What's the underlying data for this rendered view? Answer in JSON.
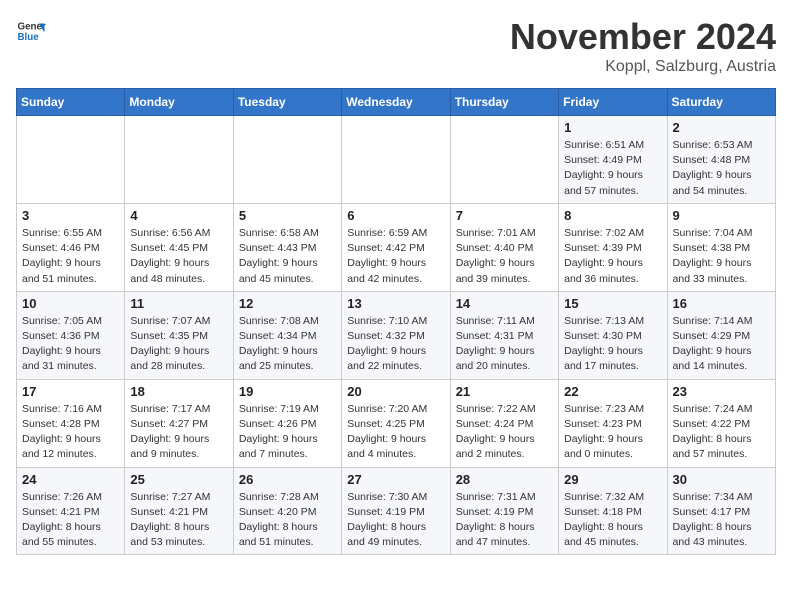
{
  "header": {
    "logo_line1": "General",
    "logo_line2": "Blue",
    "month": "November 2024",
    "location": "Koppl, Salzburg, Austria"
  },
  "weekdays": [
    "Sunday",
    "Monday",
    "Tuesday",
    "Wednesday",
    "Thursday",
    "Friday",
    "Saturday"
  ],
  "weeks": [
    [
      {
        "day": "",
        "info": ""
      },
      {
        "day": "",
        "info": ""
      },
      {
        "day": "",
        "info": ""
      },
      {
        "day": "",
        "info": ""
      },
      {
        "day": "",
        "info": ""
      },
      {
        "day": "1",
        "info": "Sunrise: 6:51 AM\nSunset: 4:49 PM\nDaylight: 9 hours and 57 minutes."
      },
      {
        "day": "2",
        "info": "Sunrise: 6:53 AM\nSunset: 4:48 PM\nDaylight: 9 hours and 54 minutes."
      }
    ],
    [
      {
        "day": "3",
        "info": "Sunrise: 6:55 AM\nSunset: 4:46 PM\nDaylight: 9 hours and 51 minutes."
      },
      {
        "day": "4",
        "info": "Sunrise: 6:56 AM\nSunset: 4:45 PM\nDaylight: 9 hours and 48 minutes."
      },
      {
        "day": "5",
        "info": "Sunrise: 6:58 AM\nSunset: 4:43 PM\nDaylight: 9 hours and 45 minutes."
      },
      {
        "day": "6",
        "info": "Sunrise: 6:59 AM\nSunset: 4:42 PM\nDaylight: 9 hours and 42 minutes."
      },
      {
        "day": "7",
        "info": "Sunrise: 7:01 AM\nSunset: 4:40 PM\nDaylight: 9 hours and 39 minutes."
      },
      {
        "day": "8",
        "info": "Sunrise: 7:02 AM\nSunset: 4:39 PM\nDaylight: 9 hours and 36 minutes."
      },
      {
        "day": "9",
        "info": "Sunrise: 7:04 AM\nSunset: 4:38 PM\nDaylight: 9 hours and 33 minutes."
      }
    ],
    [
      {
        "day": "10",
        "info": "Sunrise: 7:05 AM\nSunset: 4:36 PM\nDaylight: 9 hours and 31 minutes."
      },
      {
        "day": "11",
        "info": "Sunrise: 7:07 AM\nSunset: 4:35 PM\nDaylight: 9 hours and 28 minutes."
      },
      {
        "day": "12",
        "info": "Sunrise: 7:08 AM\nSunset: 4:34 PM\nDaylight: 9 hours and 25 minutes."
      },
      {
        "day": "13",
        "info": "Sunrise: 7:10 AM\nSunset: 4:32 PM\nDaylight: 9 hours and 22 minutes."
      },
      {
        "day": "14",
        "info": "Sunrise: 7:11 AM\nSunset: 4:31 PM\nDaylight: 9 hours and 20 minutes."
      },
      {
        "day": "15",
        "info": "Sunrise: 7:13 AM\nSunset: 4:30 PM\nDaylight: 9 hours and 17 minutes."
      },
      {
        "day": "16",
        "info": "Sunrise: 7:14 AM\nSunset: 4:29 PM\nDaylight: 9 hours and 14 minutes."
      }
    ],
    [
      {
        "day": "17",
        "info": "Sunrise: 7:16 AM\nSunset: 4:28 PM\nDaylight: 9 hours and 12 minutes."
      },
      {
        "day": "18",
        "info": "Sunrise: 7:17 AM\nSunset: 4:27 PM\nDaylight: 9 hours and 9 minutes."
      },
      {
        "day": "19",
        "info": "Sunrise: 7:19 AM\nSunset: 4:26 PM\nDaylight: 9 hours and 7 minutes."
      },
      {
        "day": "20",
        "info": "Sunrise: 7:20 AM\nSunset: 4:25 PM\nDaylight: 9 hours and 4 minutes."
      },
      {
        "day": "21",
        "info": "Sunrise: 7:22 AM\nSunset: 4:24 PM\nDaylight: 9 hours and 2 minutes."
      },
      {
        "day": "22",
        "info": "Sunrise: 7:23 AM\nSunset: 4:23 PM\nDaylight: 9 hours and 0 minutes."
      },
      {
        "day": "23",
        "info": "Sunrise: 7:24 AM\nSunset: 4:22 PM\nDaylight: 8 hours and 57 minutes."
      }
    ],
    [
      {
        "day": "24",
        "info": "Sunrise: 7:26 AM\nSunset: 4:21 PM\nDaylight: 8 hours and 55 minutes."
      },
      {
        "day": "25",
        "info": "Sunrise: 7:27 AM\nSunset: 4:21 PM\nDaylight: 8 hours and 53 minutes."
      },
      {
        "day": "26",
        "info": "Sunrise: 7:28 AM\nSunset: 4:20 PM\nDaylight: 8 hours and 51 minutes."
      },
      {
        "day": "27",
        "info": "Sunrise: 7:30 AM\nSunset: 4:19 PM\nDaylight: 8 hours and 49 minutes."
      },
      {
        "day": "28",
        "info": "Sunrise: 7:31 AM\nSunset: 4:19 PM\nDaylight: 8 hours and 47 minutes."
      },
      {
        "day": "29",
        "info": "Sunrise: 7:32 AM\nSunset: 4:18 PM\nDaylight: 8 hours and 45 minutes."
      },
      {
        "day": "30",
        "info": "Sunrise: 7:34 AM\nSunset: 4:17 PM\nDaylight: 8 hours and 43 minutes."
      }
    ]
  ]
}
